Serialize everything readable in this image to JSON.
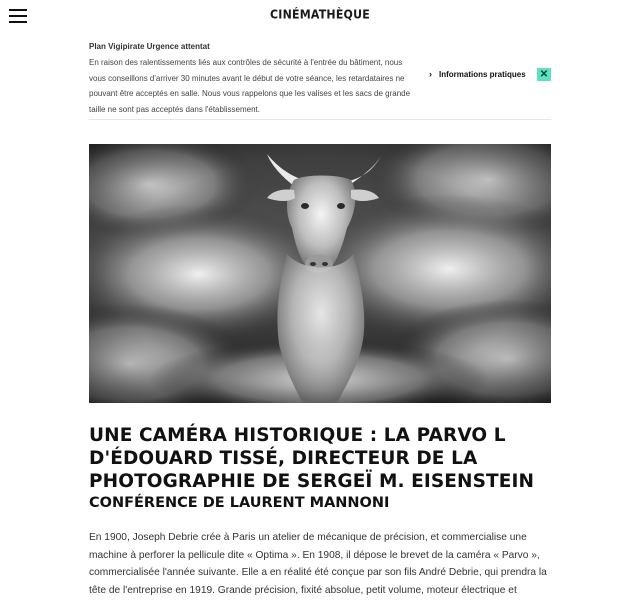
{
  "header": {
    "logo": "CINÉMATHÈQUE"
  },
  "alert": {
    "title": "Plan Vigipirate Urgence attentat",
    "text": "En raison des ralentissements liés aux contrôles de sécurité à l'entrée du bâtiment, nous vous conseillons d'arriver 30 minutes avant le début de votre séance, les retardataires ne pouvant être acceptés en salle. Nous vous rappelons que les valises et les sacs de grande taille ne sont pas acceptés dans l'établissement.",
    "info_link": "Informations pratiques",
    "close_label": "✕"
  },
  "article": {
    "title": "UNE CAMÉRA HISTORIQUE : LA PARVO L D'ÉDOUARD TISSÉ, DIRECTEUR DE LA PHOTOGRAPHIE DE SERGEÏ M. EISENSTEIN",
    "subtitle": "CONFÉRENCE DE LAURENT MANNONI",
    "body": "En 1900, Joseph Debrie crée à Paris un atelier de mécanique de précision, et commercialise une machine à perforer la pellicule dite « Optima ». En 1908, il dépose le brevet de la caméra « Parvo », commercialisée l'année suivante. Elle a en réalité été conçue par son fils André Debrie, qui prendra la tête de l'entreprise en 1919. Grande précision, fixité absolue, petit volume, moteur électrique et d'excellents objectifs : la"
  },
  "colors": {
    "close_accent": "#5ce1c1",
    "text": "#1a1a1a"
  }
}
